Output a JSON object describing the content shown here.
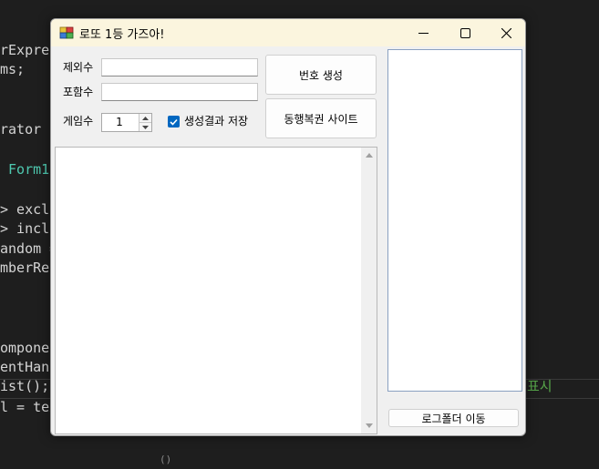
{
  "background_code": {
    "lines": [
      {
        "text": "rExpres",
        "color": "plain"
      },
      {
        "text": "ms;",
        "color": "plain"
      },
      {
        "text": "rator",
        "color": "plain"
      },
      {
        "text": " Form1",
        "color": "teal"
      },
      {
        "text": "> exclu",
        "color": "plain"
      },
      {
        "text": "> inclu",
        "color": "plain"
      },
      {
        "text": "andom =",
        "color": "plain"
      },
      {
        "text": "mberReg",
        "color": "plain"
      },
      {
        "text": "omponent",
        "color": "plain"
      },
      {
        "text": "entHand",
        "color": "plain"
      },
      {
        "text": "ist();",
        "color": "plain"
      },
      {
        "text": "l = tex",
        "color": "plain"
      }
    ],
    "right_fragment": "표시",
    "bottom_fragment": "()"
  },
  "window": {
    "title": "로또 1등 가즈아!",
    "controls": {
      "minimize": "minimize-icon",
      "maximize": "maximize-icon",
      "close": "close-icon"
    }
  },
  "form": {
    "exclude_label": "제외수",
    "exclude_value": "",
    "include_label": "포함수",
    "include_value": "",
    "game_count_label": "게임수",
    "game_count_value": "1",
    "save_result_label": "생성결과 저장",
    "save_result_checked": true,
    "generate_button": "번호 생성",
    "site_button": "동행복권 사이트",
    "log_folder_button": "로그폴더 이동"
  },
  "output": {
    "text": ""
  },
  "log_list": {
    "items": []
  },
  "colors": {
    "titlebar": "#fbf5de",
    "checkbox_accent": "#0067c0",
    "ide_background": "#1e1e1e"
  }
}
